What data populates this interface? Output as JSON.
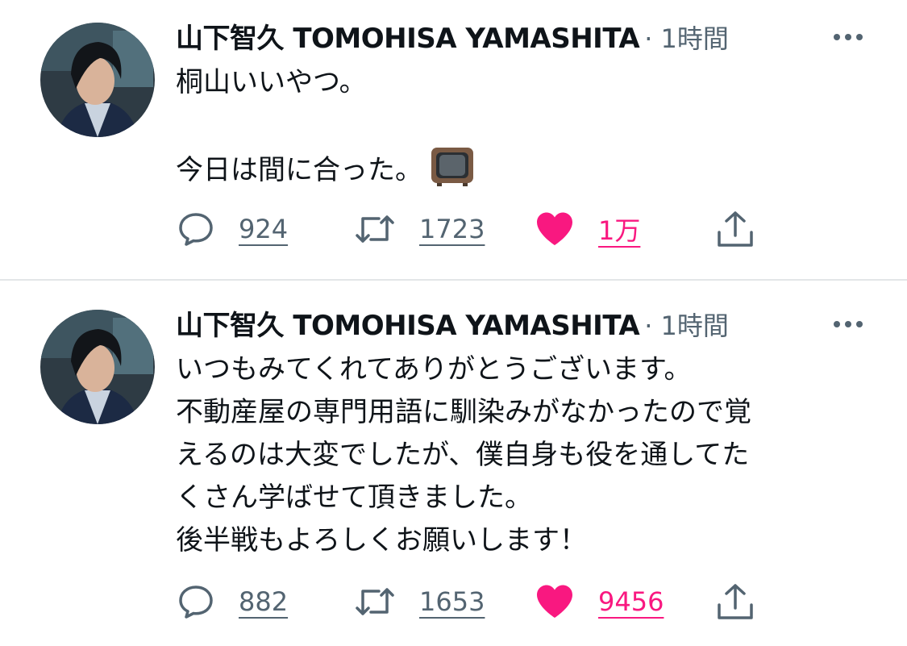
{
  "colors": {
    "text": "#0f1419",
    "secondary": "#536471",
    "like": "#f91880",
    "divider": "#e3e6e8"
  },
  "tweets": [
    {
      "author_name": "山下智久 TOMOHISA YAMASHITA",
      "meta": "· 1時間",
      "body": "桐山いいやつ。\n\n今日は間に合った。",
      "emoji": "television-emoji",
      "reply_count": "924",
      "retweet_count": "1723",
      "like_count": "1万",
      "liked": true
    },
    {
      "author_name": "山下智久 TOMOHISA YAMASHITA",
      "meta": "· 1時間",
      "body": "いつもみてくれてありがとうございます。\n不動産屋の専門用語に馴染みがなかったので覚\nえるのは大変でしたが、僕自身も役を通してた\nくさん学ばせて頂きました。\n後半戦もよろしくお願いします！",
      "reply_count": "882",
      "retweet_count": "1653",
      "like_count": "9456",
      "liked": true
    }
  ]
}
